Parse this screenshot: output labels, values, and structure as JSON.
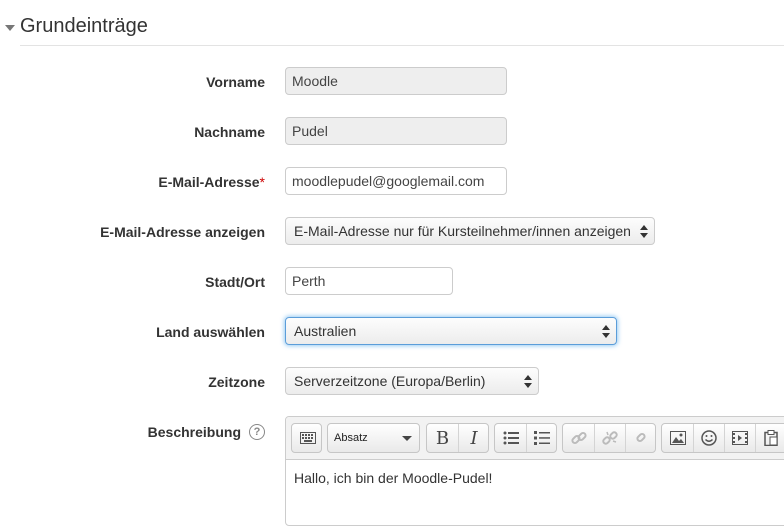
{
  "section": {
    "title": "Grundeinträge"
  },
  "fields": {
    "firstname": {
      "label": "Vorname",
      "value": "Moodle"
    },
    "lastname": {
      "label": "Nachname",
      "value": "Pudel"
    },
    "email": {
      "label": "E-Mail-Adresse",
      "required_mark": "*",
      "value": "moodlepudel@googlemail.com"
    },
    "maildisplay": {
      "label": "E-Mail-Adresse anzeigen",
      "value": "E-Mail-Adresse nur für Kursteilnehmer/innen anzeigen"
    },
    "city": {
      "label": "Stadt/Ort",
      "value": "Perth"
    },
    "country": {
      "label": "Land auswählen",
      "value": "Australien"
    },
    "timezone": {
      "label": "Zeitzone",
      "value": "Serverzeitzone (Europa/Berlin)"
    },
    "description": {
      "label": "Beschreibung",
      "help_icon": "question-circle-icon",
      "text": "Hallo, ich bin der Moodle-Pudel!"
    }
  },
  "editor": {
    "paragraph_select": "Absatz",
    "toolbar_icons": [
      "keyboard-icon",
      "bold-icon",
      "italic-icon",
      "unordered-list-icon",
      "ordered-list-icon",
      "link-icon",
      "unlink-icon",
      "anchor-icon",
      "image-icon",
      "emoticon-icon",
      "media-icon",
      "paste-icon"
    ]
  },
  "colors": {
    "required": "#cc0000",
    "focus_ring": "#5b9dd9",
    "readonly_bg": "#eeeeee"
  }
}
